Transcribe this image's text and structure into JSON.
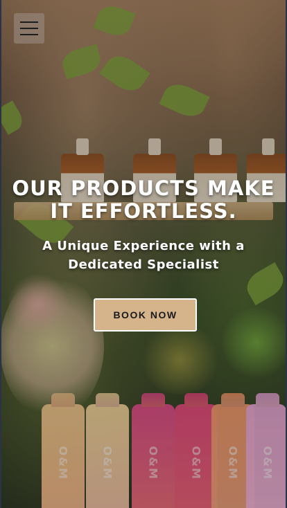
{
  "header": {
    "menu_icon": "hamburger-menu-icon"
  },
  "hero": {
    "title": "OUR PRODUCTS MAKE IT EFFORTLESS.",
    "subtitle": "A Unique Experience with a Dedicated Specialist",
    "cta_label": "BOOK NOW",
    "cta_color": "#d5b48b"
  },
  "background": {
    "product_tube_text": [
      "O&M",
      "O&M",
      "O&M",
      "O&M",
      "O&M",
      "O&M"
    ]
  }
}
